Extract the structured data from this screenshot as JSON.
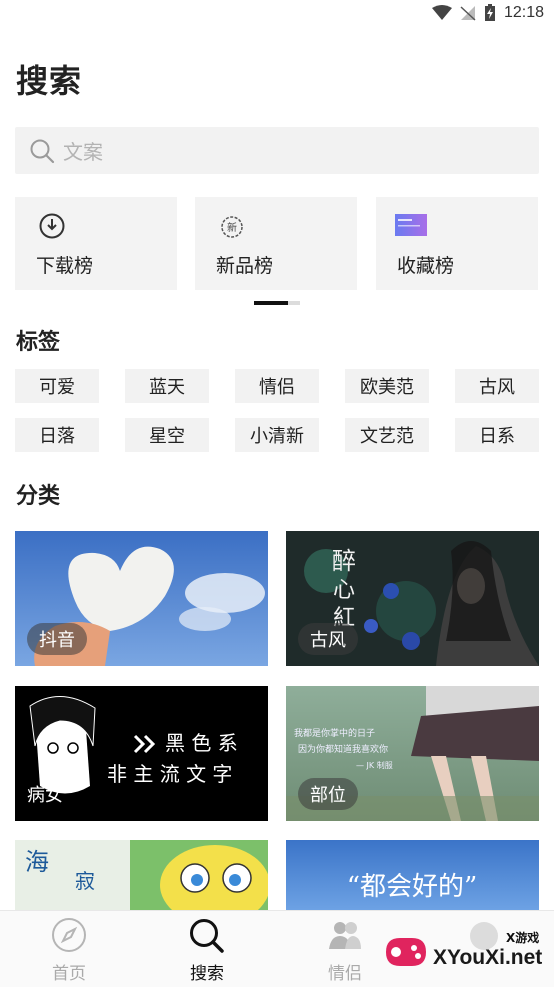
{
  "status_bar": {
    "time": "12:18"
  },
  "page_title": "搜索",
  "search": {
    "placeholder": "文案"
  },
  "rankings": [
    {
      "label": "下载榜",
      "icon": "download-clock-icon"
    },
    {
      "label": "新品榜",
      "icon": "new-badge-icon"
    },
    {
      "label": "收藏榜",
      "icon": "collection-thumbnail-icon"
    }
  ],
  "tags_section": {
    "title": "标签",
    "tags": [
      "可爱",
      "蓝天",
      "情侣",
      "欧美范",
      "古风",
      "日落",
      "星空",
      "小清新",
      "文艺范",
      "日系"
    ]
  },
  "category_section": {
    "title": "分类",
    "cards": [
      {
        "label": "抖音"
      },
      {
        "label": "古风",
        "art_text": "醉心紅"
      },
      {
        "label": "病女",
        "art_text": "黑色系 非主流文字"
      },
      {
        "label": "部位",
        "art_text": "我都是你掌中的日子 因为你都知道我喜欢你"
      },
      {
        "label": "",
        "art_text": "海 寂"
      },
      {
        "label": "",
        "art_text": "“都会好的”"
      }
    ]
  },
  "bottom_nav": [
    {
      "label": "首页",
      "icon": "compass-icon",
      "active": false
    },
    {
      "label": "搜索",
      "icon": "search-icon",
      "active": true
    },
    {
      "label": "情侣",
      "icon": "couple-icon",
      "active": false
    }
  ],
  "watermark": {
    "site": "XYouXi.net",
    "badge": "X游戏"
  },
  "colors": {
    "active": "#111111",
    "inactive": "#aaaaaa",
    "chip_bg": "#f2f2f2"
  }
}
